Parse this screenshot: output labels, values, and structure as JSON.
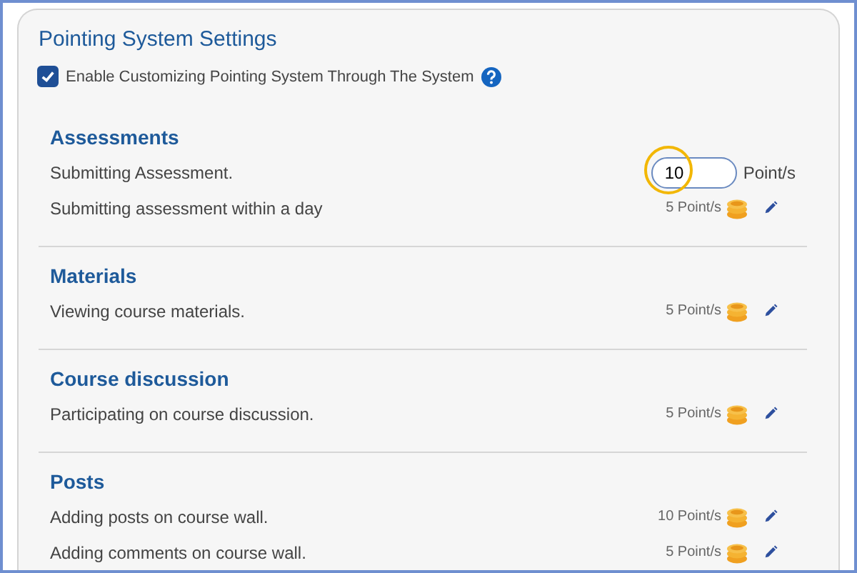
{
  "title": "Pointing System Settings",
  "enable": {
    "label": "Enable Customizing Pointing System Through The System",
    "checked": true
  },
  "sections": [
    {
      "heading": "Assessments",
      "rows": [
        {
          "kind": "edit",
          "label": "Submitting Assessment.",
          "value": "10",
          "unit": "Point/s"
        },
        {
          "kind": "display",
          "label": "Submitting assessment within a day",
          "points": "5 Point/s"
        }
      ]
    },
    {
      "heading": "Materials",
      "rows": [
        {
          "kind": "display",
          "label": "Viewing course materials.",
          "points": "5 Point/s"
        }
      ]
    },
    {
      "heading": "Course discussion",
      "rows": [
        {
          "kind": "display",
          "label": "Participating on course discussion.",
          "points": "5 Point/s"
        }
      ]
    },
    {
      "heading": "Posts",
      "rows": [
        {
          "kind": "display",
          "label": "Adding posts on course wall.",
          "points": "10 Point/s"
        },
        {
          "kind": "display",
          "label": "Adding comments on course wall.",
          "points": "5 Point/s"
        }
      ]
    }
  ]
}
